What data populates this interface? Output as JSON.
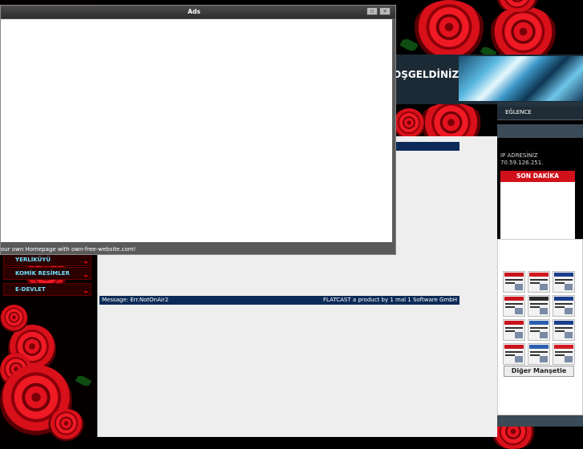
{
  "header": {
    "title": "OŞGELDİNİZ"
  },
  "right_sidebar": {
    "entertainment_label": "EĞLENCE",
    "ip_label": "IP ADRESİNİZ",
    "ip_value": "70.59.126.251.",
    "breaking_news_label": "SON DAKİKA",
    "more_headlines_button": "Diğer Manşetle"
  },
  "left_menu": {
    "items": [
      {
        "label": "YERLİKÜYÜ"
      },
      {
        "label": "KOMİK RESİMLER"
      },
      {
        "label": "E-DEVLET"
      }
    ]
  },
  "flatcast": {
    "message": "Message: Err.NotOnAir2",
    "credit": "FLATCAST a product by 1 mal 1 Software GmbH"
  },
  "ads_window": {
    "title": "Ads",
    "status_text": "our own Homepage with own-free-website.com!",
    "restore_glyph": "▫",
    "close_glyph": "×"
  },
  "colors": {
    "rose_red": "#e3121e",
    "bar_blue": "#0b2a57",
    "menu_text": "#6fe2ff",
    "breaking_red": "#d0101a"
  }
}
